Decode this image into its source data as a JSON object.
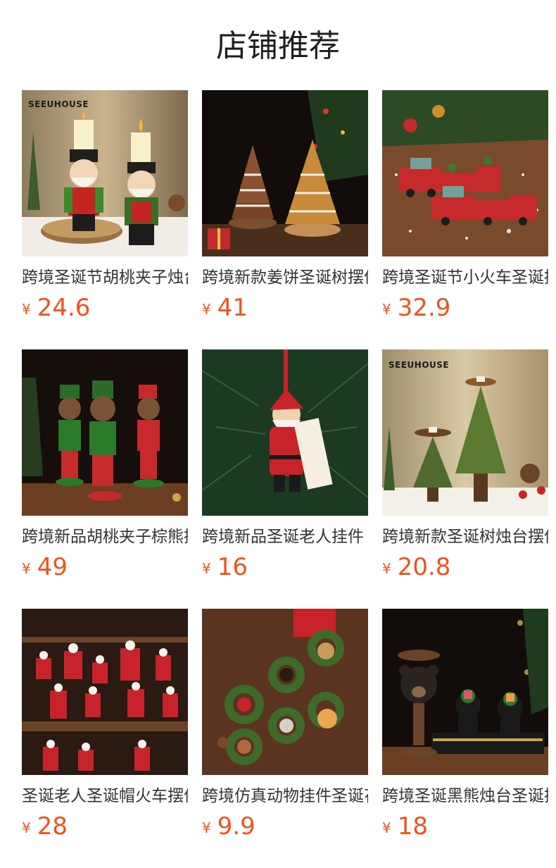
{
  "section_title": "店铺推荐",
  "currency_symbol": "¥",
  "accent_color": "#f0521e",
  "products": [
    {
      "name": "跨境圣诞节胡桃夹子烛台摆件",
      "price": "24.6",
      "brand_watermark": "SEEUHOUSE"
    },
    {
      "name": "跨境新款姜饼圣诞树摆件",
      "price": "41"
    },
    {
      "name": "跨境圣诞节小火车圣诞摆件",
      "price": "32.9"
    },
    {
      "name": "跨境新品胡桃夹子棕熊摆件",
      "price": "49"
    },
    {
      "name": "跨境新品圣诞老人挂件",
      "price": "16"
    },
    {
      "name": "跨境新款圣诞树烛台摆件",
      "price": "20.8",
      "brand_watermark": "SEEUHOUSE"
    },
    {
      "name": "圣诞老人圣诞帽火车摆件",
      "price": "28"
    },
    {
      "name": "跨境仿真动物挂件圣诞花环",
      "price": "9.9"
    },
    {
      "name": "跨境圣诞黑熊烛台圣诞摆件",
      "price": "18"
    }
  ]
}
